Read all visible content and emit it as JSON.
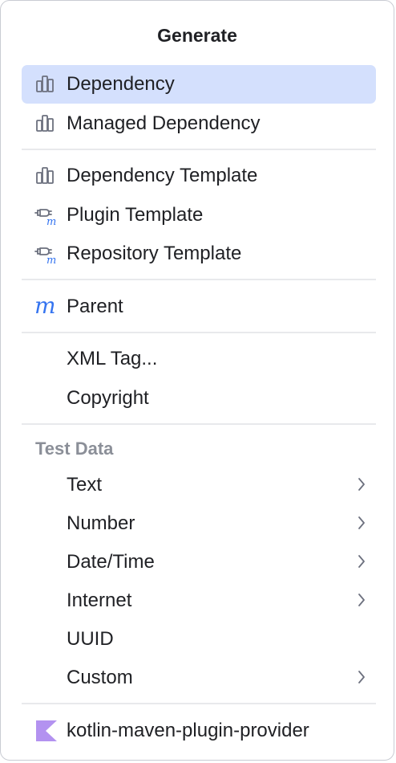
{
  "popup": {
    "title": "Generate"
  },
  "group1": {
    "dependency": "Dependency",
    "managed_dependency": "Managed Dependency"
  },
  "group2": {
    "dependency_template": "Dependency Template",
    "plugin_template": "Plugin Template",
    "repository_template": "Repository Template"
  },
  "group3": {
    "parent": "Parent",
    "parent_icon_glyph": "m"
  },
  "group4": {
    "xml_tag": "XML Tag...",
    "copyright": "Copyright"
  },
  "test_data": {
    "header": "Test Data",
    "items": [
      {
        "label": "Text",
        "has_submenu": true
      },
      {
        "label": "Number",
        "has_submenu": true
      },
      {
        "label": "Date/Time",
        "has_submenu": true
      },
      {
        "label": "Internet",
        "has_submenu": true
      },
      {
        "label": "UUID",
        "has_submenu": false
      },
      {
        "label": "Custom",
        "has_submenu": true
      }
    ]
  },
  "footer": {
    "provider": "kotlin-maven-plugin-provider"
  },
  "icons": {
    "dependency": "dependency-bars-icon",
    "plugin": "maven-plugin-icon",
    "parent": "maven-m-icon",
    "kotlin": "kotlin-logo-icon",
    "submenu": "chevron-right-icon"
  },
  "colors": {
    "selection": "#d4e0fd",
    "maven_blue": "#3574f0",
    "icon_gray": "#6c707e",
    "kotlin_purple": "#b392f0",
    "section_header": "#8b8f98"
  }
}
